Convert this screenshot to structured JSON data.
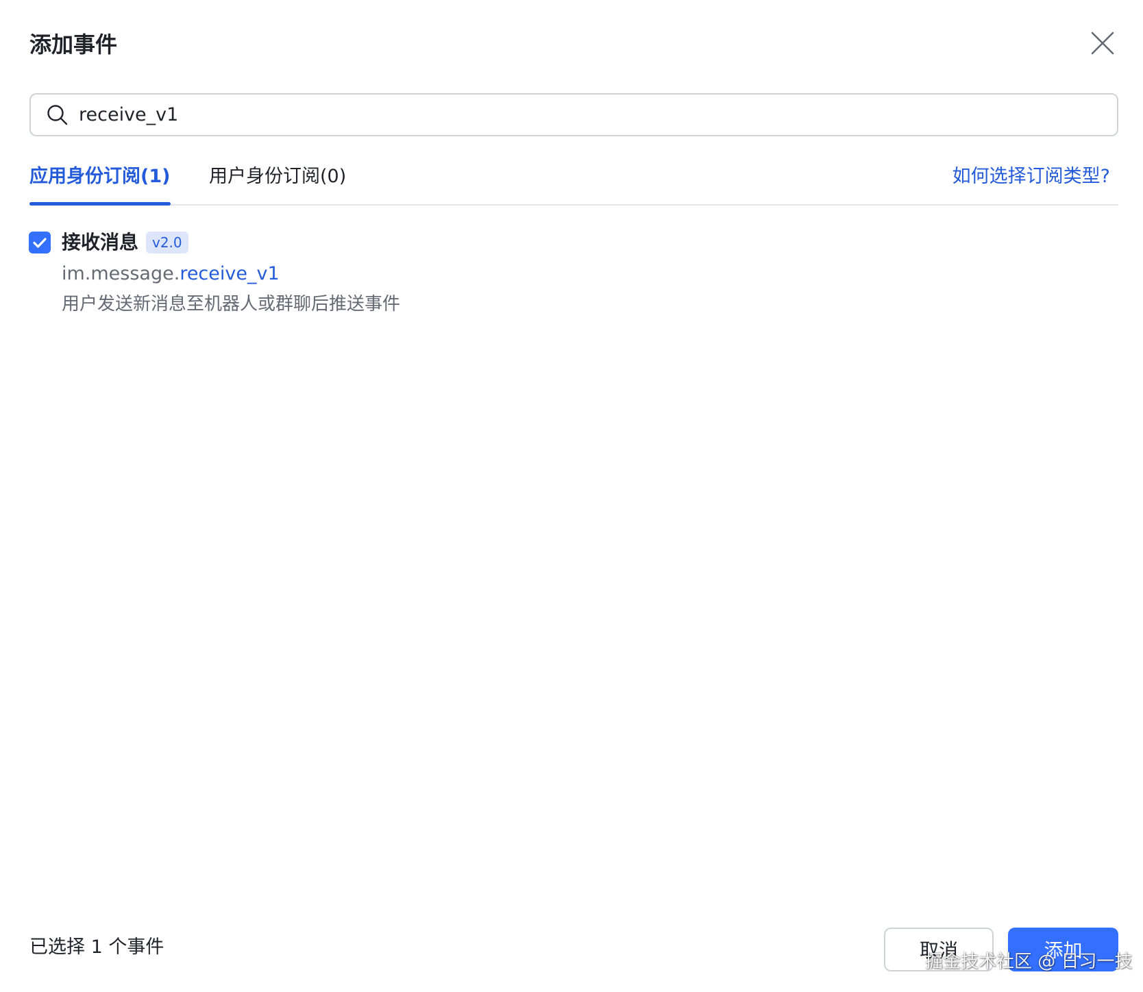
{
  "dialog": {
    "title": "添加事件",
    "close_icon": "close-icon"
  },
  "search": {
    "icon": "search-icon",
    "value": "receive_v1",
    "placeholder": ""
  },
  "tabs": [
    {
      "label": "应用身份订阅(1)",
      "active": true
    },
    {
      "label": "用户身份订阅(0)",
      "active": false
    }
  ],
  "help_link": "如何选择订阅类型?",
  "events": [
    {
      "checked": true,
      "name": "接收消息",
      "version": "v2.0",
      "key_prefix": "im.message.",
      "key_match": "receive_v1",
      "description": "用户发送新消息至机器人或群聊后推送事件"
    }
  ],
  "footer": {
    "selected_text": "已选择 1 个事件",
    "cancel_label": "取消",
    "add_label": "添加"
  },
  "watermark": "掘金技术社区 @ 日习一技",
  "colors": {
    "accent": "#3370ff",
    "link": "#245bdb",
    "badge_bg": "#dde5fb",
    "text_secondary": "#646a73"
  }
}
